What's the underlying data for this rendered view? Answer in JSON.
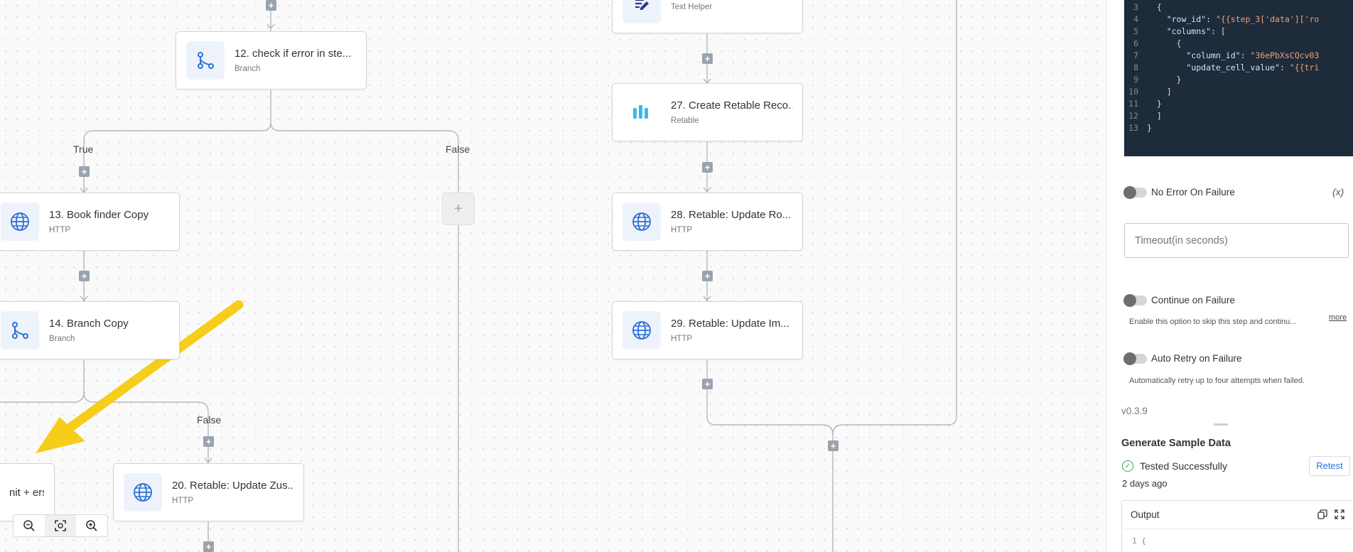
{
  "nodes": [
    {
      "id": "n12",
      "title": "12. check if error in ste...",
      "sub": "Branch",
      "icon": "branch-icon"
    },
    {
      "id": "n13",
      "title": "13. Book finder Copy",
      "sub": "HTTP",
      "icon": "globe-icon"
    },
    {
      "id": "n14",
      "title": "14. Branch Copy",
      "sub": "Branch",
      "icon": "branch-icon"
    },
    {
      "id": "n_edit",
      "title": "nit + ers...",
      "sub": "",
      "icon": ""
    },
    {
      "id": "n20",
      "title": "20. Retable: Update Zus...",
      "sub": "HTTP",
      "icon": "globe-icon"
    },
    {
      "id": "n_text",
      "title": "",
      "sub": "Text Helper",
      "icon": "text-helper-icon"
    },
    {
      "id": "n27",
      "title": "27. Create Retable Reco...",
      "sub": "Retable",
      "icon": "retable-icon"
    },
    {
      "id": "n28",
      "title": "28. Retable: Update Ro...",
      "sub": "HTTP",
      "icon": "globe-icon"
    },
    {
      "id": "n29",
      "title": "29. Retable: Update Im...",
      "sub": "HTTP",
      "icon": "globe-icon"
    }
  ],
  "branch_labels": {
    "true1": "True",
    "false1": "False",
    "false2": "False"
  },
  "code": {
    "lines": [
      {
        "n": "3",
        "tokens": [
          {
            "t": "  {",
            "c": "p"
          }
        ]
      },
      {
        "n": "4",
        "tokens": [
          {
            "t": "    \"row_id\"",
            "c": "k"
          },
          {
            "t": ": ",
            "c": "p"
          },
          {
            "t": "\"{{step_3['data']['ro",
            "c": "s"
          }
        ]
      },
      {
        "n": "5",
        "tokens": [
          {
            "t": "    \"columns\"",
            "c": "k"
          },
          {
            "t": ": [",
            "c": "p"
          }
        ]
      },
      {
        "n": "6",
        "tokens": [
          {
            "t": "      {",
            "c": "p"
          }
        ]
      },
      {
        "n": "7",
        "tokens": [
          {
            "t": "        \"column_id\"",
            "c": "k"
          },
          {
            "t": ": ",
            "c": "p"
          },
          {
            "t": "\"36ePbXsCQcv03",
            "c": "s"
          }
        ]
      },
      {
        "n": "8",
        "tokens": [
          {
            "t": "        \"update_cell_value\"",
            "c": "k"
          },
          {
            "t": ": ",
            "c": "p"
          },
          {
            "t": "\"{{tri",
            "c": "s"
          }
        ]
      },
      {
        "n": "9",
        "tokens": [
          {
            "t": "      }",
            "c": "p"
          }
        ]
      },
      {
        "n": "10",
        "tokens": [
          {
            "t": "    ]",
            "c": "p"
          }
        ]
      },
      {
        "n": "11",
        "tokens": [
          {
            "t": "  }",
            "c": "p"
          }
        ]
      },
      {
        "n": "12",
        "tokens": [
          {
            "t": "  ]",
            "c": "p"
          }
        ]
      },
      {
        "n": "13",
        "tokens": [
          {
            "t": "}",
            "c": "p"
          }
        ]
      }
    ]
  },
  "panel": {
    "fx_label": "(x)",
    "no_error_label": "No Error On Failure",
    "timeout_placeholder": "Timeout(in seconds)",
    "continue_label": "Continue on Failure",
    "continue_hint": "Enable this option to skip this step and continu...",
    "more_label": "more",
    "auto_retry_label": "Auto Retry on Failure",
    "auto_retry_hint": "Automatically retry up to four attempts when failed.",
    "version": "v0.3.9",
    "sample_title": "Generate Sample Data",
    "tested_label": "Tested Successfully",
    "retest_label": "Retest",
    "tested_ago": "2 days ago",
    "output_label": "Output",
    "output_first_line": "1  {"
  },
  "colors": {
    "accent": "#2d6fd6",
    "arrow": "#f7cd1b",
    "success": "#3fa55b"
  }
}
